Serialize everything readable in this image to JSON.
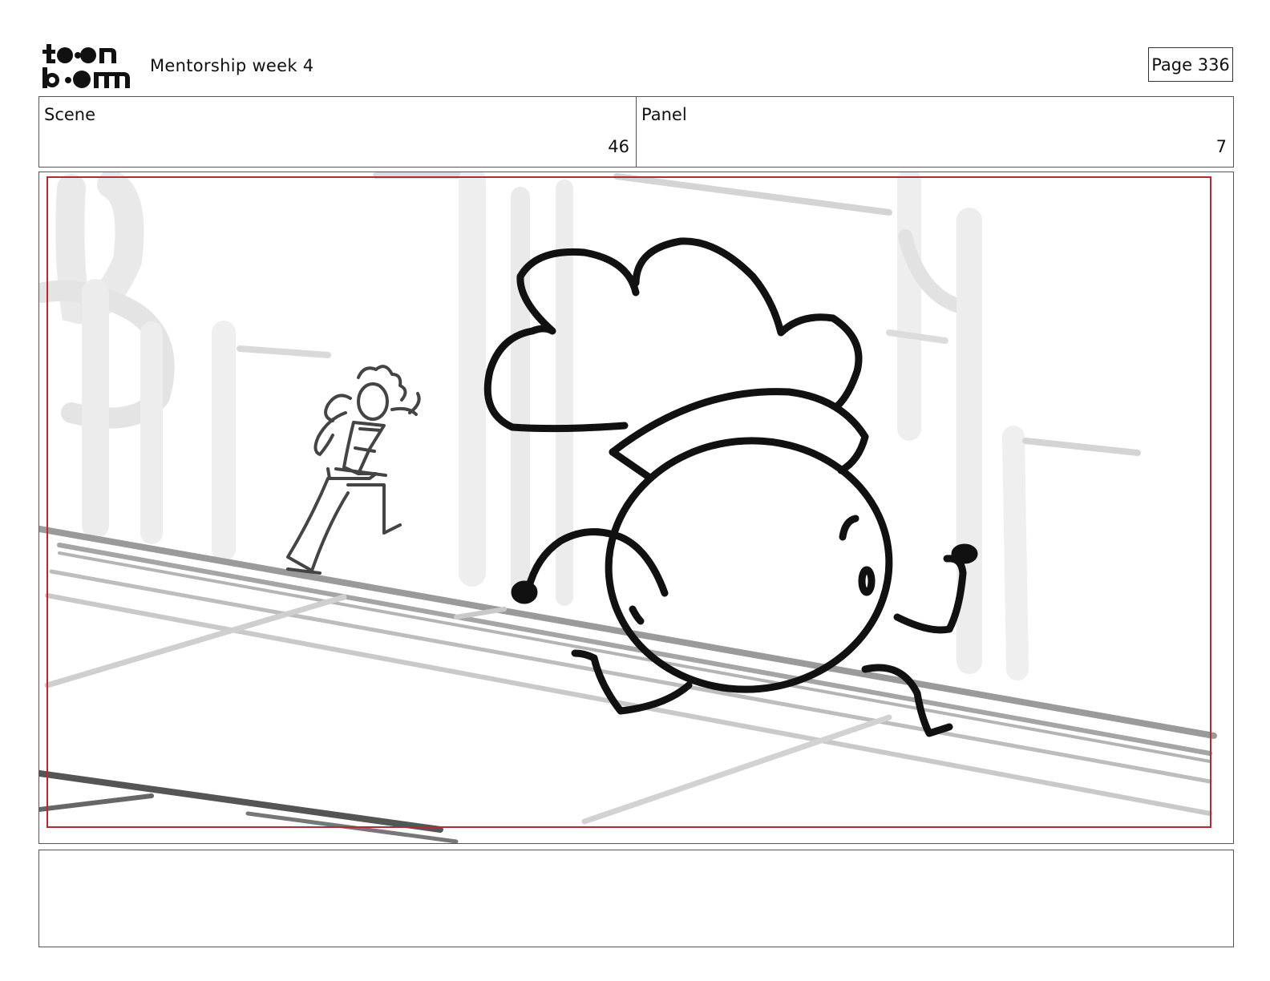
{
  "header": {
    "logo_icon": "toon-boom-logo",
    "project_title": "Mentorship week 4",
    "page_label": "Page 336"
  },
  "info": {
    "scene_label": "Scene",
    "scene_value": "46",
    "panel_label": "Panel",
    "panel_value": "7"
  },
  "drawing": {
    "safe_frame_color": "#b22a35",
    "line_color": "#111111"
  },
  "notes": {
    "text": ""
  }
}
